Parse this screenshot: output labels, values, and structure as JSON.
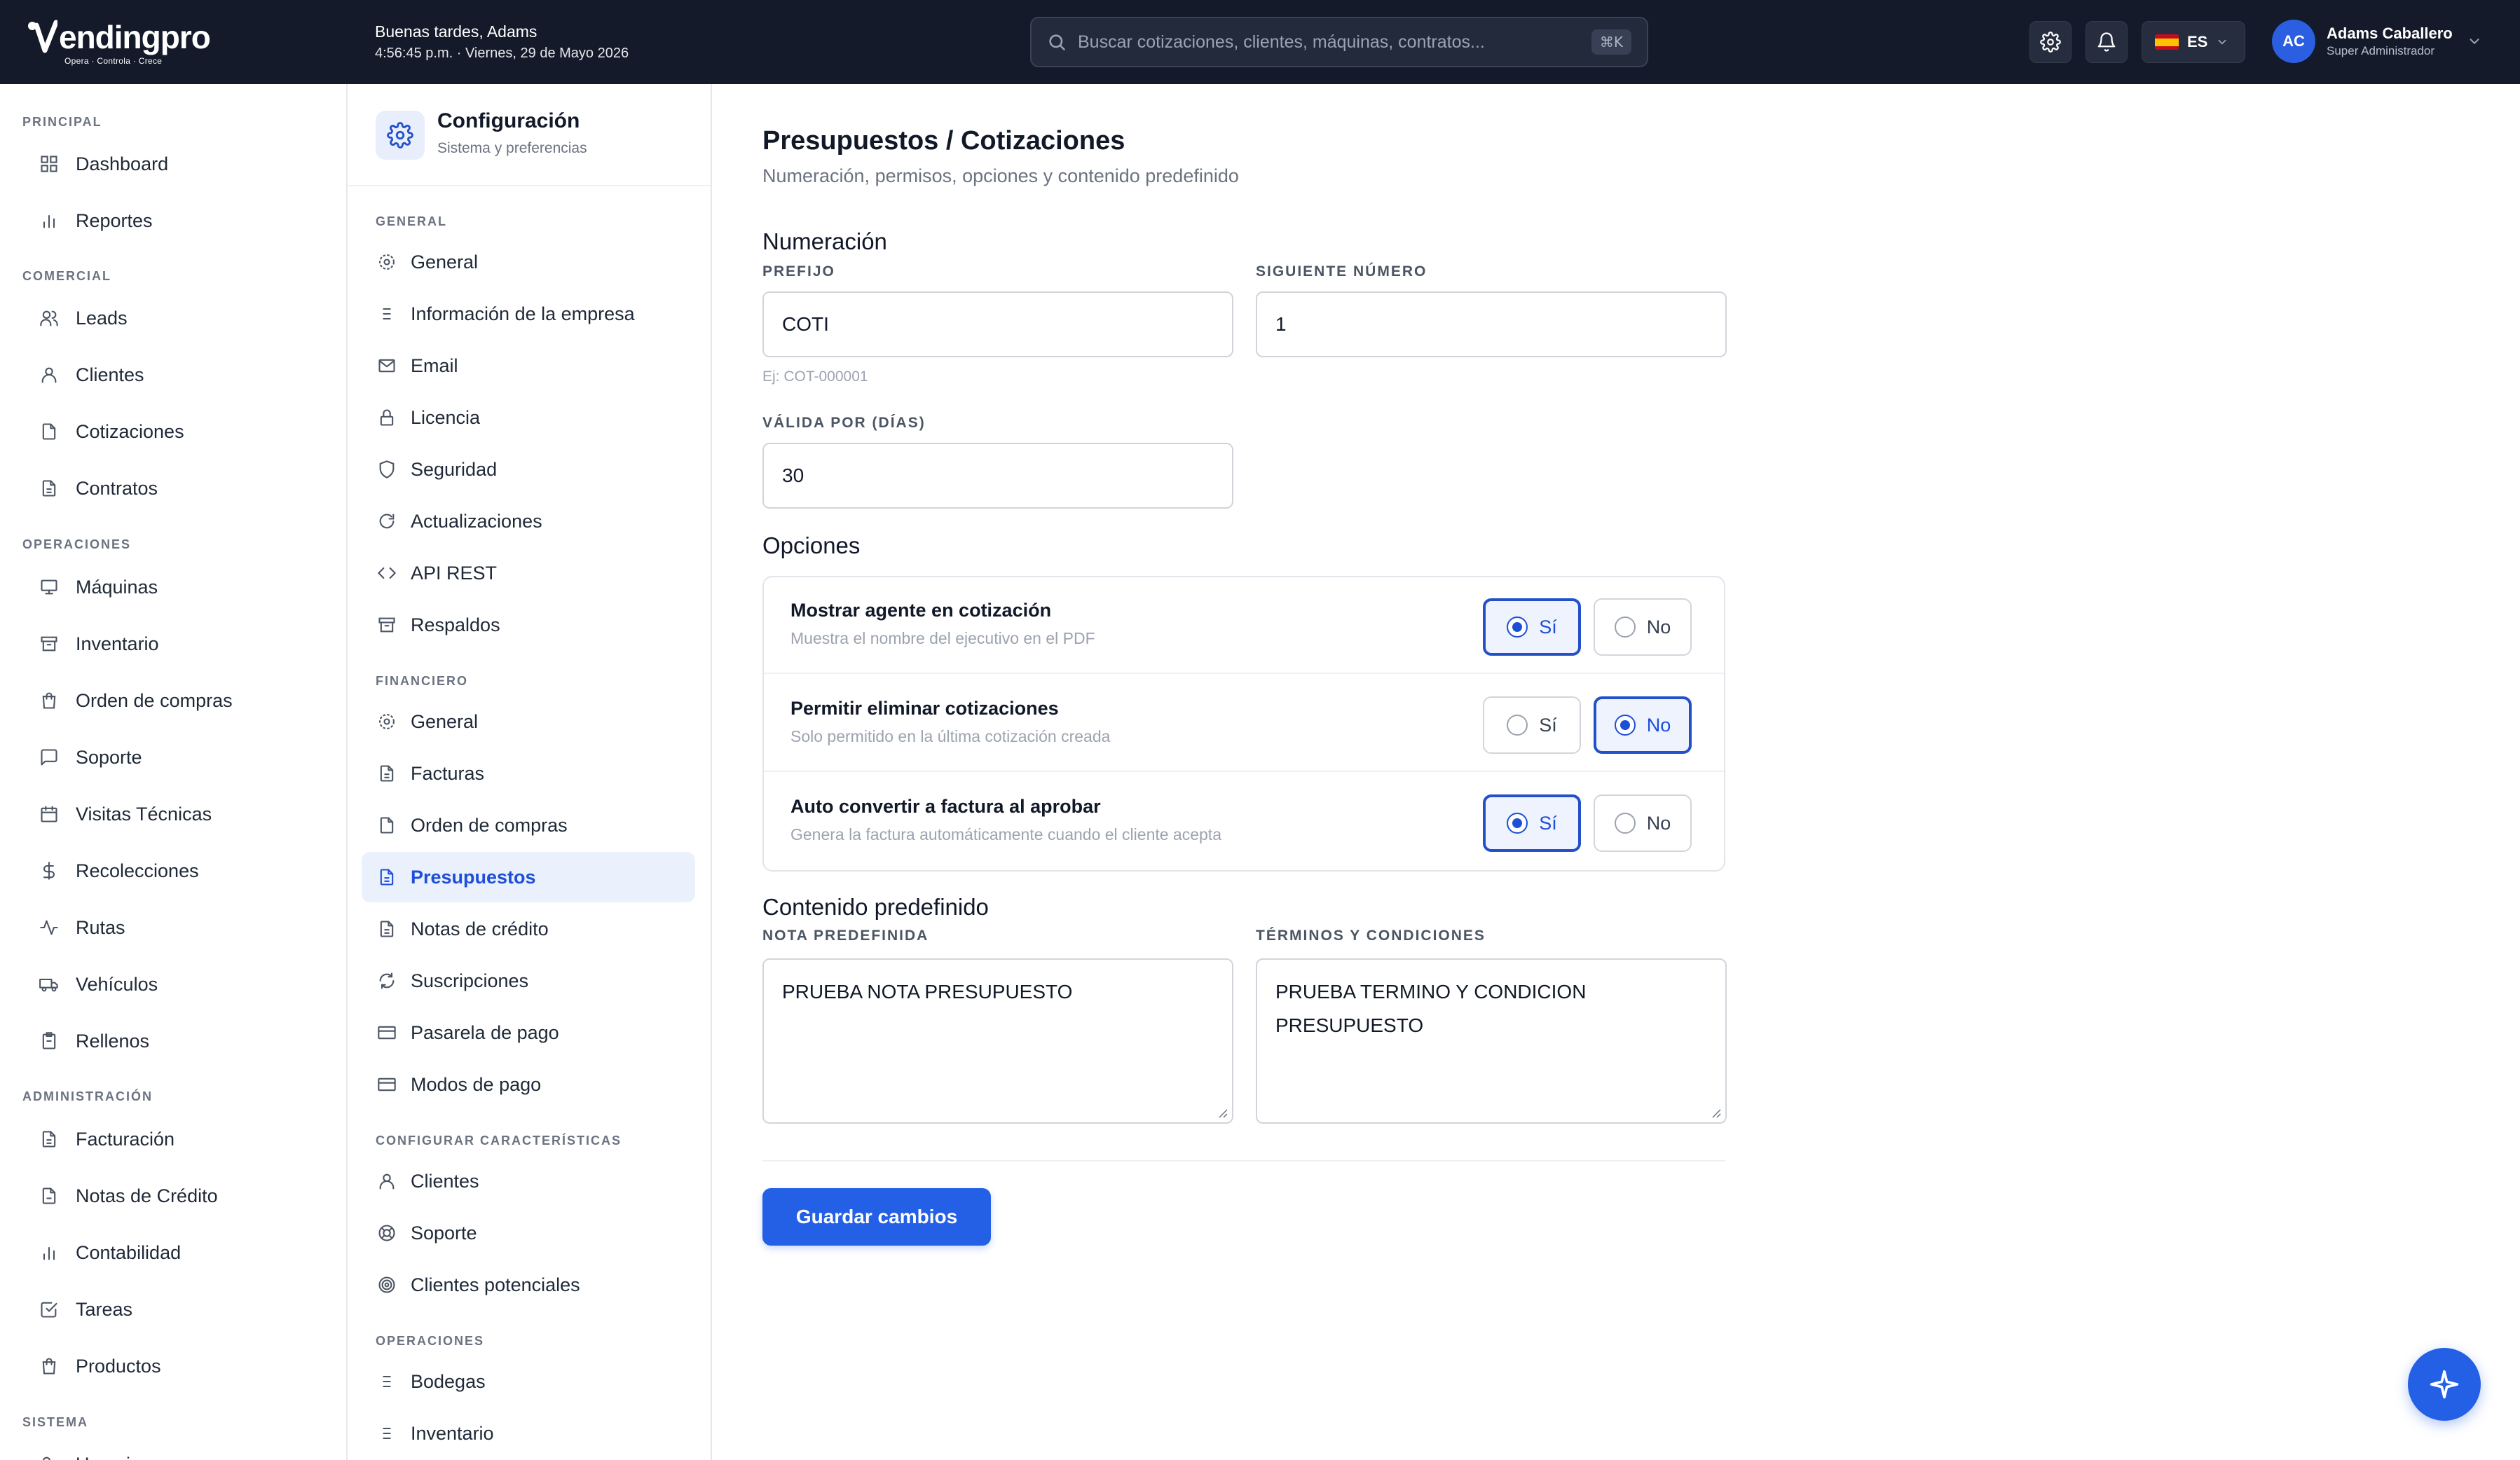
{
  "brand": {
    "name": "endingpro",
    "tagline": "Opera · Controla · Crece"
  },
  "header": {
    "greeting": "Buenas tardes, Adams",
    "datetime": "4:56:45 p.m. · Viernes, 29 de Mayo 2026",
    "search_placeholder": "Buscar cotizaciones, clientes, máquinas, contratos...",
    "search_shortcut": "⌘K",
    "language": "ES",
    "user_initials": "AC",
    "user_name": "Adams Caballero",
    "user_role": "Super Administrador"
  },
  "sidebar": {
    "sections": [
      {
        "label": "PRINCIPAL",
        "items": [
          "Dashboard",
          "Reportes"
        ]
      },
      {
        "label": "COMERCIAL",
        "items": [
          "Leads",
          "Clientes",
          "Cotizaciones",
          "Contratos"
        ]
      },
      {
        "label": "OPERACIONES",
        "items": [
          "Máquinas",
          "Inventario",
          "Orden de compras",
          "Soporte",
          "Visitas Técnicas",
          "Recolecciones",
          "Rutas",
          "Vehículos",
          "Rellenos"
        ]
      },
      {
        "label": "ADMINISTRACIÓN",
        "items": [
          "Facturación",
          "Notas de Crédito",
          "Contabilidad",
          "Tareas",
          "Productos"
        ]
      },
      {
        "label": "SISTEMA",
        "items": [
          "Usuarios"
        ]
      }
    ]
  },
  "config": {
    "title": "Configuración",
    "subtitle": "Sistema y preferencias",
    "sections": [
      {
        "label": "GENERAL",
        "items": [
          "General",
          "Información de la empresa",
          "Email",
          "Licencia",
          "Seguridad",
          "Actualizaciones",
          "API REST",
          "Respaldos"
        ]
      },
      {
        "label": "FINANCIERO",
        "items": [
          "General",
          "Facturas",
          "Orden de compras",
          "Presupuestos",
          "Notas de crédito",
          "Suscripciones",
          "Pasarela de pago",
          "Modos de pago"
        ]
      },
      {
        "label": "CONFIGURAR CARACTERÍSTICAS",
        "items": [
          "Clientes",
          "Soporte",
          "Clientes potenciales"
        ]
      },
      {
        "label": "OPERACIONES",
        "items": [
          "Bodegas",
          "Inventario"
        ]
      }
    ],
    "active": "Presupuestos"
  },
  "main": {
    "title": "Presupuestos / Cotizaciones",
    "subtitle": "Numeración, permisos, opciones y contenido predefinido",
    "numbering": {
      "heading": "Numeración",
      "prefix_label": "PREFIJO",
      "prefix_value": "COTI",
      "prefix_hint": "Ej: COT-000001",
      "next_label": "SIGUIENTE NÚMERO",
      "next_value": "1",
      "valid_label": "VÁLIDA POR (DÍAS)",
      "valid_value": "30"
    },
    "options": {
      "heading": "Opciones",
      "yes_label": "Sí",
      "no_label": "No",
      "rows": [
        {
          "title": "Mostrar agente en cotización",
          "desc": "Muestra el nombre del ejecutivo en el PDF",
          "selected": "yes"
        },
        {
          "title": "Permitir eliminar cotizaciones",
          "desc": "Solo permitido en la última cotización creada",
          "selected": "no"
        },
        {
          "title": "Auto convertir a factura al aprobar",
          "desc": "Genera la factura automáticamente cuando el cliente acepta",
          "selected": "yes"
        }
      ]
    },
    "content": {
      "heading": "Contenido predefinido",
      "note_label": "NOTA PREDEFINIDA",
      "note_value": "PRUEBA NOTA PRESUPUESTO",
      "terms_label": "TÉRMINOS Y CONDICIONES",
      "terms_value": "PRUEBA TERMINO Y CONDICION PRESUPUESTO"
    },
    "save_label": "Guardar cambios"
  },
  "colors": {
    "topbar": "#141a2a",
    "accent": "#2460e6",
    "active_bg": "#eaf1fd"
  }
}
